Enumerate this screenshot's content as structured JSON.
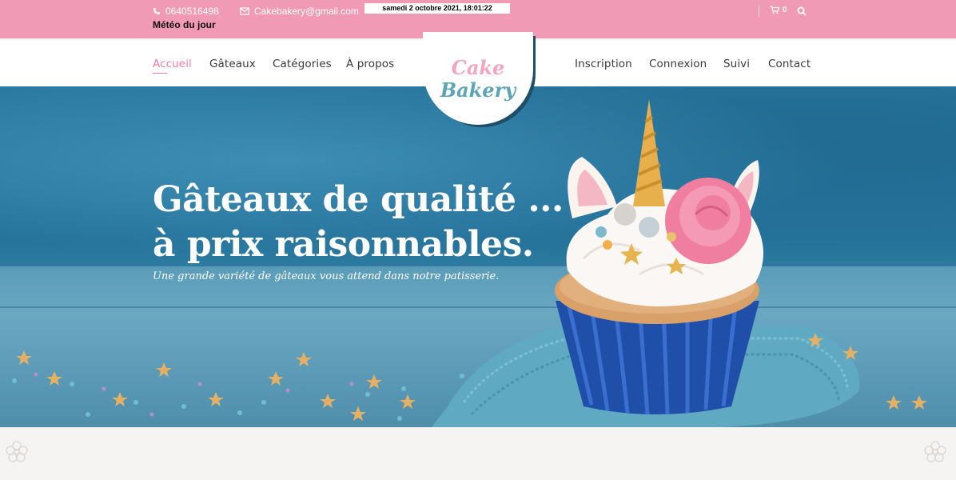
{
  "topbar": {
    "phone": "0640516498",
    "email": "Cakebakery@gmail.com",
    "datetime": "samedi 2 octobre 2021, 18:01:22",
    "weather": "Météo du jour",
    "cart_count": "0",
    "icons": [
      "phone-icon",
      "mail-icon",
      "cart-icon",
      "search-icon"
    ]
  },
  "nav": {
    "left": [
      {
        "label": "Accueil",
        "active": true
      },
      {
        "label": "Gâteaux"
      },
      {
        "label": "Catégories"
      },
      {
        "label": "À propos"
      }
    ],
    "right": [
      {
        "label": "Inscription"
      },
      {
        "label": "Connexion"
      },
      {
        "label": "Suivi"
      },
      {
        "label": "Contact"
      }
    ]
  },
  "logo": {
    "line1": "Cake",
    "line2": "Bakery"
  },
  "hero": {
    "title_line1": "Gâteaux de qualité ...",
    "title_line2": "à prix raisonnables.",
    "subtitle": "Une grande variété de gâteaux vous attend dans notre patisserie.",
    "image": "unicorn-cupcake-image"
  },
  "colors": {
    "topbar": "#f09ab5",
    "accent": "#f07ea0",
    "logo_pink": "#f3a5bd",
    "logo_teal": "#5ca4b6",
    "hero_blue": "#2e7fa6"
  }
}
